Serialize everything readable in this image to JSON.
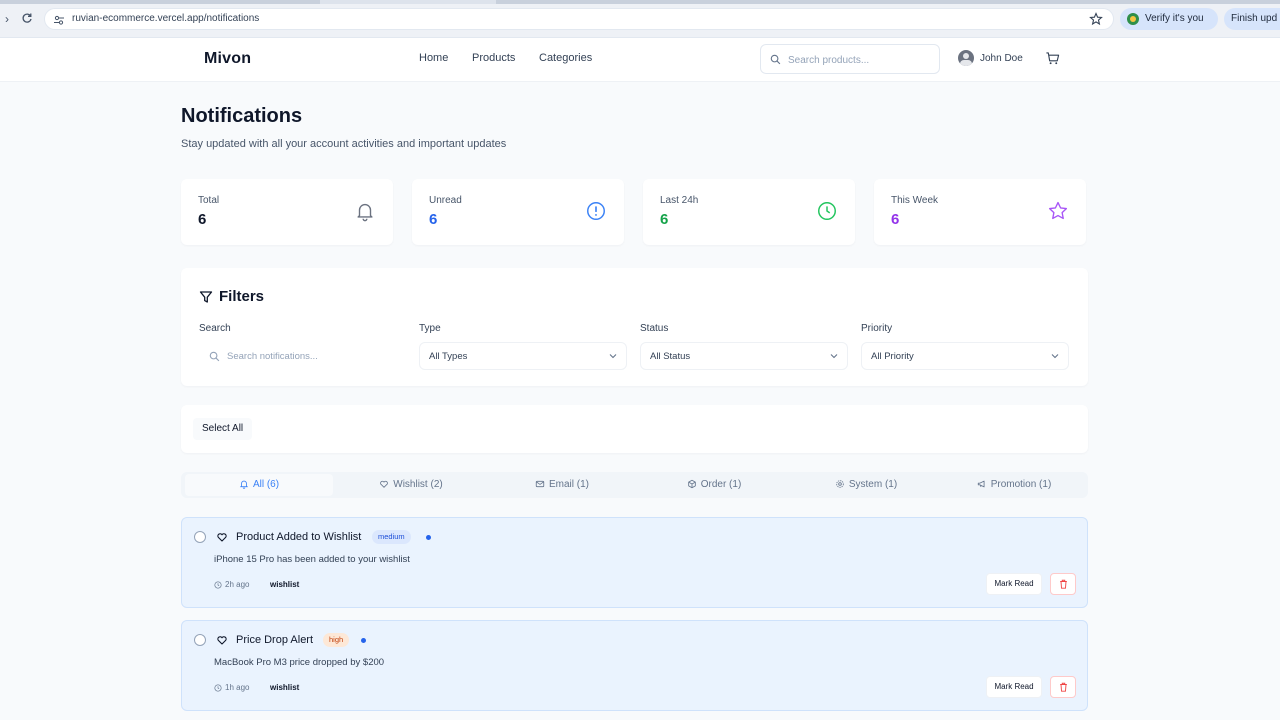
{
  "browser": {
    "url": "ruvian-ecommerce.vercel.app/notifications",
    "verify_label": "Verify it's you",
    "finish_label": "Finish upd"
  },
  "site": {
    "logo": "Mivon",
    "nav": [
      "Home",
      "Products",
      "Categories"
    ],
    "search_placeholder": "Search products...",
    "user_name": "John Doe"
  },
  "page": {
    "title": "Notifications",
    "subtitle": "Stay updated with all your account activities and important updates"
  },
  "stats": [
    {
      "label": "Total",
      "value": "6",
      "color": "#0f172a",
      "icon": "bell-icon"
    },
    {
      "label": "Unread",
      "value": "6",
      "color": "#2563eb",
      "icon": "alert-circle-icon"
    },
    {
      "label": "Last 24h",
      "value": "6",
      "color": "#16a34a",
      "icon": "clock-icon"
    },
    {
      "label": "This Week",
      "value": "6",
      "color": "#9333ea",
      "icon": "star-icon"
    }
  ],
  "filters": {
    "title": "Filters",
    "search_label": "Search",
    "search_placeholder": "Search notifications...",
    "type_label": "Type",
    "type_value": "All Types",
    "status_label": "Status",
    "status_value": "All Status",
    "priority_label": "Priority",
    "priority_value": "All Priority"
  },
  "select_all_label": "Select All",
  "tabs": [
    {
      "label": "All (6)",
      "icon": "bell-icon",
      "active": true
    },
    {
      "label": "Wishlist (2)",
      "icon": "heart-icon"
    },
    {
      "label": "Email (1)",
      "icon": "mail-icon"
    },
    {
      "label": "Order (1)",
      "icon": "package-icon"
    },
    {
      "label": "System (1)",
      "icon": "gear-icon"
    },
    {
      "label": "Promotion (1)",
      "icon": "megaphone-icon"
    }
  ],
  "notifications": [
    {
      "title": "Product Added to Wishlist",
      "priority": "medium",
      "message": "iPhone 15 Pro has been added to your wishlist",
      "time": "2h ago",
      "tag": "wishlist",
      "mark_read_label": "Mark Read"
    },
    {
      "title": "Price Drop Alert",
      "priority": "high",
      "message": "MacBook Pro M3 price dropped by $200",
      "time": "1h ago",
      "tag": "wishlist",
      "mark_read_label": "Mark Read"
    }
  ],
  "colors": {
    "accent": "#3b82f6",
    "unread_card_bg": "#eaf3fe",
    "delete_red": "#ef4444"
  }
}
